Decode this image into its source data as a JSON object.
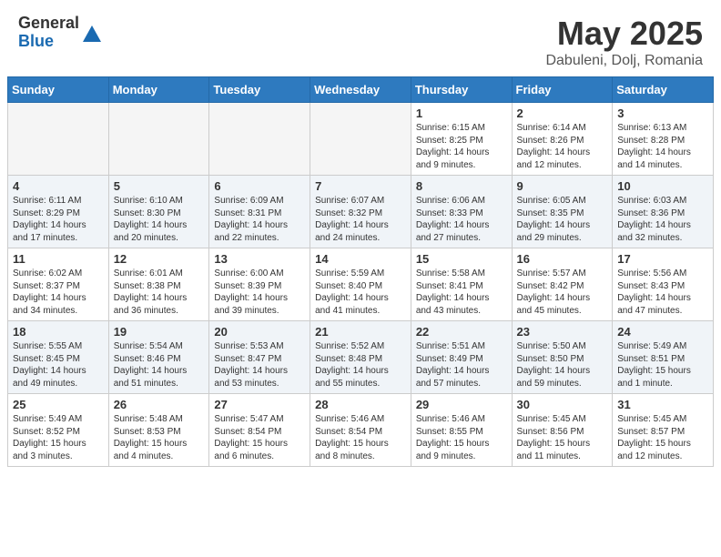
{
  "header": {
    "logo_general": "General",
    "logo_blue": "Blue",
    "month_title": "May 2025",
    "location": "Dabuleni, Dolj, Romania"
  },
  "weekdays": [
    "Sunday",
    "Monday",
    "Tuesday",
    "Wednesday",
    "Thursday",
    "Friday",
    "Saturday"
  ],
  "weeks": [
    [
      {
        "day": "",
        "info": ""
      },
      {
        "day": "",
        "info": ""
      },
      {
        "day": "",
        "info": ""
      },
      {
        "day": "",
        "info": ""
      },
      {
        "day": "1",
        "info": "Sunrise: 6:15 AM\nSunset: 8:25 PM\nDaylight: 14 hours and 9 minutes."
      },
      {
        "day": "2",
        "info": "Sunrise: 6:14 AM\nSunset: 8:26 PM\nDaylight: 14 hours and 12 minutes."
      },
      {
        "day": "3",
        "info": "Sunrise: 6:13 AM\nSunset: 8:28 PM\nDaylight: 14 hours and 14 minutes."
      }
    ],
    [
      {
        "day": "4",
        "info": "Sunrise: 6:11 AM\nSunset: 8:29 PM\nDaylight: 14 hours and 17 minutes."
      },
      {
        "day": "5",
        "info": "Sunrise: 6:10 AM\nSunset: 8:30 PM\nDaylight: 14 hours and 20 minutes."
      },
      {
        "day": "6",
        "info": "Sunrise: 6:09 AM\nSunset: 8:31 PM\nDaylight: 14 hours and 22 minutes."
      },
      {
        "day": "7",
        "info": "Sunrise: 6:07 AM\nSunset: 8:32 PM\nDaylight: 14 hours and 24 minutes."
      },
      {
        "day": "8",
        "info": "Sunrise: 6:06 AM\nSunset: 8:33 PM\nDaylight: 14 hours and 27 minutes."
      },
      {
        "day": "9",
        "info": "Sunrise: 6:05 AM\nSunset: 8:35 PM\nDaylight: 14 hours and 29 minutes."
      },
      {
        "day": "10",
        "info": "Sunrise: 6:03 AM\nSunset: 8:36 PM\nDaylight: 14 hours and 32 minutes."
      }
    ],
    [
      {
        "day": "11",
        "info": "Sunrise: 6:02 AM\nSunset: 8:37 PM\nDaylight: 14 hours and 34 minutes."
      },
      {
        "day": "12",
        "info": "Sunrise: 6:01 AM\nSunset: 8:38 PM\nDaylight: 14 hours and 36 minutes."
      },
      {
        "day": "13",
        "info": "Sunrise: 6:00 AM\nSunset: 8:39 PM\nDaylight: 14 hours and 39 minutes."
      },
      {
        "day": "14",
        "info": "Sunrise: 5:59 AM\nSunset: 8:40 PM\nDaylight: 14 hours and 41 minutes."
      },
      {
        "day": "15",
        "info": "Sunrise: 5:58 AM\nSunset: 8:41 PM\nDaylight: 14 hours and 43 minutes."
      },
      {
        "day": "16",
        "info": "Sunrise: 5:57 AM\nSunset: 8:42 PM\nDaylight: 14 hours and 45 minutes."
      },
      {
        "day": "17",
        "info": "Sunrise: 5:56 AM\nSunset: 8:43 PM\nDaylight: 14 hours and 47 minutes."
      }
    ],
    [
      {
        "day": "18",
        "info": "Sunrise: 5:55 AM\nSunset: 8:45 PM\nDaylight: 14 hours and 49 minutes."
      },
      {
        "day": "19",
        "info": "Sunrise: 5:54 AM\nSunset: 8:46 PM\nDaylight: 14 hours and 51 minutes."
      },
      {
        "day": "20",
        "info": "Sunrise: 5:53 AM\nSunset: 8:47 PM\nDaylight: 14 hours and 53 minutes."
      },
      {
        "day": "21",
        "info": "Sunrise: 5:52 AM\nSunset: 8:48 PM\nDaylight: 14 hours and 55 minutes."
      },
      {
        "day": "22",
        "info": "Sunrise: 5:51 AM\nSunset: 8:49 PM\nDaylight: 14 hours and 57 minutes."
      },
      {
        "day": "23",
        "info": "Sunrise: 5:50 AM\nSunset: 8:50 PM\nDaylight: 14 hours and 59 minutes."
      },
      {
        "day": "24",
        "info": "Sunrise: 5:49 AM\nSunset: 8:51 PM\nDaylight: 15 hours and 1 minute."
      }
    ],
    [
      {
        "day": "25",
        "info": "Sunrise: 5:49 AM\nSunset: 8:52 PM\nDaylight: 15 hours and 3 minutes."
      },
      {
        "day": "26",
        "info": "Sunrise: 5:48 AM\nSunset: 8:53 PM\nDaylight: 15 hours and 4 minutes."
      },
      {
        "day": "27",
        "info": "Sunrise: 5:47 AM\nSunset: 8:54 PM\nDaylight: 15 hours and 6 minutes."
      },
      {
        "day": "28",
        "info": "Sunrise: 5:46 AM\nSunset: 8:54 PM\nDaylight: 15 hours and 8 minutes."
      },
      {
        "day": "29",
        "info": "Sunrise: 5:46 AM\nSunset: 8:55 PM\nDaylight: 15 hours and 9 minutes."
      },
      {
        "day": "30",
        "info": "Sunrise: 5:45 AM\nSunset: 8:56 PM\nDaylight: 15 hours and 11 minutes."
      },
      {
        "day": "31",
        "info": "Sunrise: 5:45 AM\nSunset: 8:57 PM\nDaylight: 15 hours and 12 minutes."
      }
    ]
  ]
}
